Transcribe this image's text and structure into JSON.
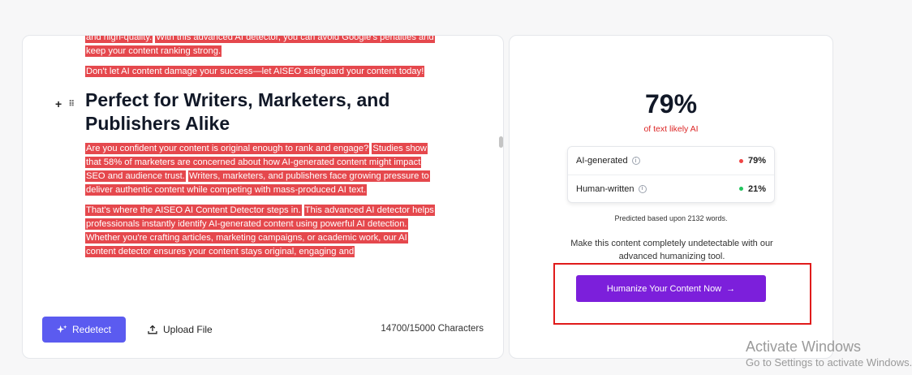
{
  "editor": {
    "paragraphs_top": [
      [
        "and high-quality.",
        "With this advanced AI detector, you can avoid Google's penalties and keep your content ranking strong."
      ],
      [
        "Don't let AI content damage your success—let AISEO safeguard your content today!"
      ]
    ],
    "heading": "Perfect for Writers, Marketers, and Publishers Alike",
    "heading_tools": {
      "add": "+",
      "drag": "⠿"
    },
    "paragraphs_bottom": [
      [
        "Are you confident your content is original enough to rank and engage?",
        "Studies show that 58% of marketers are concerned about how AI-generated content might impact SEO and audience trust.",
        "Writers, marketers, and publishers face growing pressure to deliver authentic content while competing with mass-produced AI text."
      ],
      [
        "That's where the AISEO AI Content Detector steps in.",
        "This advanced AI detector helps professionals instantly identify AI-generated content using powerful AI detection.",
        "Whether you're crafting articles, marketing campaigns, or academic work, our AI content detector ensures your content stays original, engaging and"
      ]
    ],
    "highlight_color": "#e5484d"
  },
  "toolbar": {
    "redetect_label": "Redetect",
    "redetect_icon": "sparkle-icon",
    "upload_label": "Upload File",
    "upload_icon": "upload-icon",
    "char_count": "14700/15000 Characters",
    "accent_color": "#5b5bf0"
  },
  "result": {
    "percent": "79%",
    "percent_label": "of text likely AI",
    "stats": [
      {
        "label": "AI-generated",
        "value": "79%",
        "dot_color": "#ef4444"
      },
      {
        "label": "Human-written",
        "value": "21%",
        "dot_color": "#22c55e"
      }
    ],
    "predicted": "Predicted based upon 2132 words.",
    "cta_text": "Make this content completely undetectable with our advanced humanizing tool.",
    "humanize_label": "Humanize Your Content Now",
    "humanize_arrow": "→",
    "humanize_color": "#7c1fdb"
  },
  "watermark": {
    "title": "Activate Windows",
    "subtitle": "Go to Settings to activate Windows."
  }
}
